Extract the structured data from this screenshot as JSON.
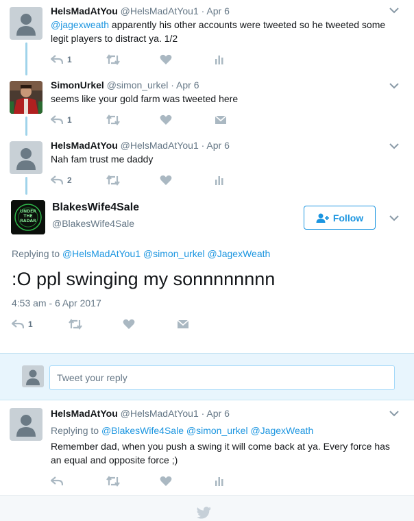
{
  "tweets": [
    {
      "name": "HelsMadAtYou",
      "handle": "@HelsMadAtYou1",
      "date": "· Apr 6",
      "mention": "@jagexweath",
      "text": " apparently his other accounts were tweeted so he tweeted some legit players to distract ya. 1/2",
      "reply_count": "1"
    },
    {
      "name": "SimonUrkel",
      "handle": "@simon_urkel",
      "date": "· Apr 6",
      "text": "seems like your gold farm was tweeted here",
      "reply_count": "1"
    },
    {
      "name": "HelsMadAtYou",
      "handle": "@HelsMadAtYou1",
      "date": "· Apr 6",
      "text": "Nah fam trust me daddy",
      "reply_count": "2"
    }
  ],
  "main_tweet": {
    "name": "BlakesWife4Sale",
    "handle": "@BlakesWife4Sale",
    "avatar_text": [
      "UNDER",
      "THE",
      "RADAR"
    ],
    "follow_label": "Follow",
    "replying_prefix": "Replying to",
    "replying_to": [
      "@HelsMadAtYou1",
      "@simon_urkel",
      "@JagexWeath"
    ],
    "text": ":O ppl swinging my sonnnnnnnn",
    "timestamp": "4:53 am - 6 Apr 2017",
    "reply_count": "1"
  },
  "reply_box": {
    "placeholder": "Tweet your reply"
  },
  "reply_tweet": {
    "name": "HelsMadAtYou",
    "handle": "@HelsMadAtYou1",
    "date": "· Apr 6",
    "replying_prefix": "Replying to",
    "replying_to": [
      "@BlakesWife4Sale",
      "@simon_urkel",
      "@JagexWeath"
    ],
    "text": "Remember dad, when you push a swing it will come back at ya. Every force has an equal and opposite force ;)"
  },
  "icons": {
    "reply": "reply-icon",
    "retweet": "retweet-icon",
    "like": "heart-icon",
    "analytics": "analytics-icon",
    "dm": "envelope-icon",
    "more": "chevron-down-icon",
    "bird": "twitter-bird-icon"
  },
  "colors": {
    "link": "#1b95e0",
    "muted": "#657786",
    "icon": "#aab8c2",
    "thread_line": "#9fd3ea",
    "reply_bar": "#e8f5fd"
  }
}
